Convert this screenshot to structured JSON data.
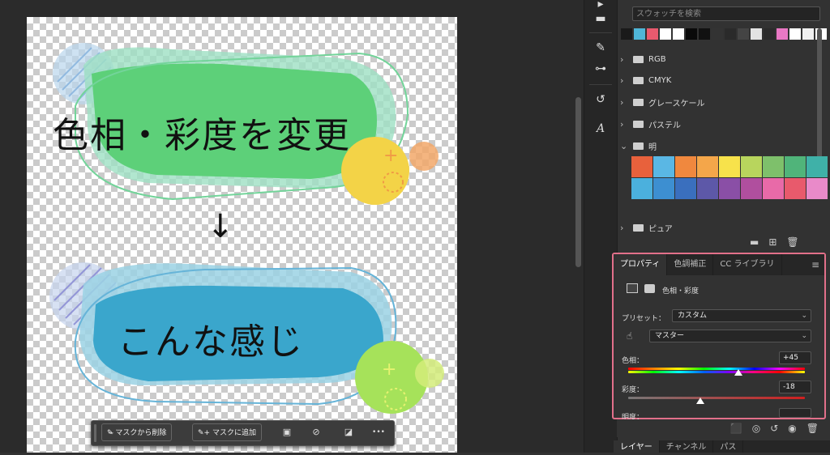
{
  "canvas": {
    "text_top": "色相・彩度を変更",
    "arrow": "↓",
    "text_bottom": "こんな感じ"
  },
  "swatches": {
    "search_placeholder": "スウォッチを検索",
    "recent_colors": [
      "#1a1a1a",
      "#4fb6d8",
      "#e95a6e",
      "#ffffff",
      "#ffffff",
      "#0a0a0a",
      "#111111",
      "#333333",
      "#2a2a2a",
      "#444444",
      "#e2e2e2",
      "#2b2b2b",
      "#e978c4",
      "#ffffff",
      "#f0f0f0",
      "#ffffff"
    ],
    "folders": [
      {
        "label": "RGB",
        "expanded": false
      },
      {
        "label": "CMYK",
        "expanded": false
      },
      {
        "label": "グレースケール",
        "expanded": false
      },
      {
        "label": "パステル",
        "expanded": false
      },
      {
        "label": "明",
        "expanded": true
      },
      {
        "label": "ピュア",
        "expanded": false
      }
    ],
    "bright_colors": [
      "#e8613c",
      "#5ab7e4",
      "#f0883e",
      "#f4a64a",
      "#f7e24b",
      "#b8d55d",
      "#7ec06b",
      "#50b47a",
      "#3fb1a8",
      "#4bb0dd",
      "#3d8fd1",
      "#3a6fbe",
      "#5d58a8",
      "#8a4fa6",
      "#b04f9e",
      "#e86aa8",
      "#e85a6c",
      "#e98ac9"
    ]
  },
  "properties": {
    "tabs": [
      "プロパティ",
      "色調補正",
      "CC ライブラリ"
    ],
    "adjustment_title": "色相・彩度",
    "preset_label": "プリセット：",
    "preset_value": "カスタム",
    "channel_value": "マスター",
    "hue_label": "色相：",
    "hue_value": "+45",
    "hue_level": 45,
    "saturation_label": "彩度：",
    "saturation_value": "-18",
    "saturation_level": -18,
    "lightness_label": "明度："
  },
  "layers_tabs": [
    "レイヤー",
    "チャンネル",
    "パス"
  ],
  "taskbar": {
    "remove_mask": "マスクから削除",
    "add_mask": "マスクに追加",
    "more": "•••"
  },
  "colors": {
    "highlight_border": "#e2708a",
    "green_blob": "#5fd07a",
    "blue_blob": "#3aa6cc"
  }
}
